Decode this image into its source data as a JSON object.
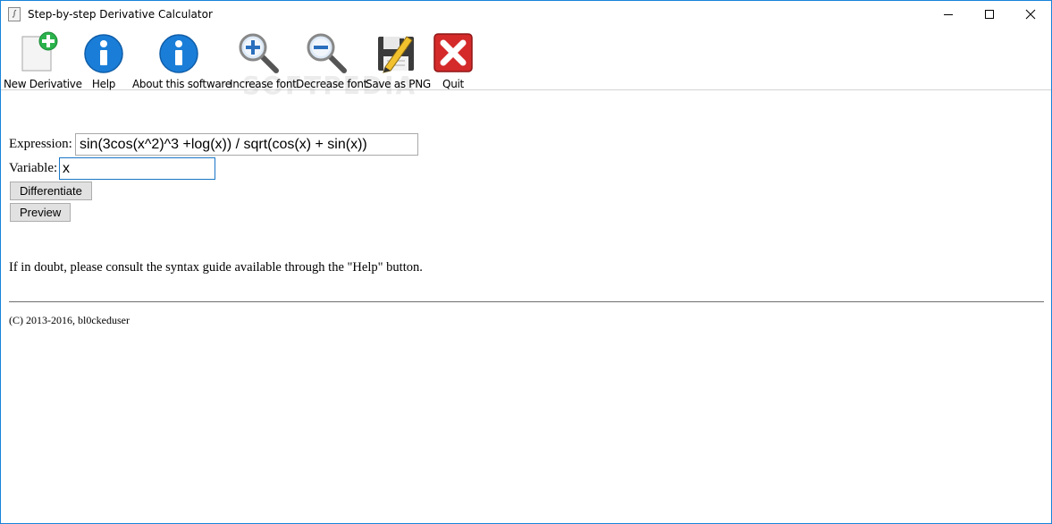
{
  "window": {
    "title": "Step-by-step Derivative Calculator",
    "app_icon_glyph": "∫",
    "controls": [
      "minimize",
      "maximize",
      "close"
    ]
  },
  "toolbar": {
    "items": [
      {
        "label": "New Derivative",
        "icon": "new-document-icon"
      },
      {
        "label": "Help",
        "icon": "info-icon"
      },
      {
        "label": "About this software",
        "icon": "info-icon"
      },
      {
        "label": "Increase font",
        "icon": "zoom-in-icon"
      },
      {
        "label": "Decrease font",
        "icon": "zoom-out-icon"
      },
      {
        "label": "Save as PNG",
        "icon": "save-disk-icon"
      },
      {
        "label": "Quit",
        "icon": "quit-x-icon"
      }
    ],
    "watermark": "SOFTPEDIA"
  },
  "form": {
    "expression_label": "Expression:",
    "expression_value": "sin(3cos(x^2)^3 +log(x)) / sqrt(cos(x) + sin(x))",
    "variable_label": "Variable:",
    "variable_value": "x",
    "differentiate_label": "Differentiate",
    "preview_label": "Preview"
  },
  "help_note": "If in doubt, please consult the syntax guide available through the \"Help\" button.",
  "footer": "(C) 2013-2016, bl0ckeduser",
  "colors": {
    "accent_border": "#1883d7",
    "info_blue": "#1a7ed8",
    "quit_red": "#d42a2a",
    "add_green": "#2bb24c"
  }
}
